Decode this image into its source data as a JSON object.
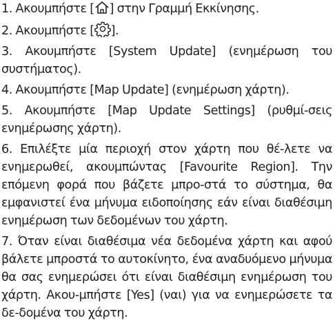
{
  "steps": [
    {
      "before": "1. Ακουμπήστε [",
      "icon": "home-icon",
      "after": "] στην Γραμμή Εκκίνησης."
    },
    {
      "before": "2. Ακουμπήστε [",
      "icon": "gear-icon",
      "after": "]."
    },
    {
      "text": "3. Ακουμπήστε [System Update] (ενημέρωση του συστήματος)."
    },
    {
      "text": "4. Ακουμπήστε [Map Update] (ενημέρωση χάρτη)."
    },
    {
      "text": "5. Ακουμπήστε [Map Update Settings] (ρυθμί-σεις ενημέρωσης χάρτη)."
    },
    {
      "text": "6. Επιλέξτε μία περιοχή στον χάρτη που θέ-λετε να ενημερωθεί, ακουμπώντας [Favourite Region]. Την επόμενη φορά που βάζετε μπρο-στά το σύστημα, θα εμφανιστεί ένα μήνυμα ειδοποίησης εάν είναι διαθέσιμη ενημέρωση των δεδομένων του χάρτη."
    },
    {
      "text": "7. Όταν είναι διαθέσιμα νέα δεδομένα χάρτη και αφού βάλετε μπροστά το αυτοκίνητο, ένα αναδυόμενο μήνυμα θα σας ενημερώσει ότι είναι διαθέσιμη ενημέρωση του χάρτη. Ακου-μπήστε [Yes] (ναι) για να ενημερώσετε τα δε-δομένα του χάρτη."
    }
  ]
}
